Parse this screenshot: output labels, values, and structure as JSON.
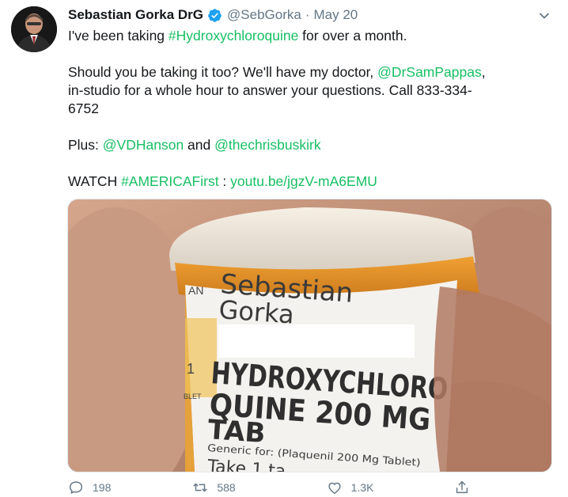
{
  "tweet": {
    "author_name": "Sebastian Gorka DrG",
    "handle": "@SebGorka",
    "separator": "·",
    "date": "May 20",
    "text": {
      "l1_a": "I've been taking ",
      "l1_tag": "#Hydroxychloroquine",
      "l1_b": " for over a month.",
      "l2_a": "Should you be taking it too? We'll have my doctor, ",
      "l2_mention": "@DrSamPappas",
      "l2_b": ",",
      "l3": "in-studio for a whole hour to answer your questions. Call 833-334-",
      "l4": "6752",
      "l5_a": "Plus: ",
      "l5_m1": "@VDHanson",
      "l5_b": " and ",
      "l5_m2": "@thechrisbuskirk",
      "l6_a": "WATCH ",
      "l6_tag": "#AMERICAFirst",
      "l6_b": " : ",
      "l6_url": "youtu.be/jgzV-mA6EMU"
    }
  },
  "media": {
    "label_name_1": "Sebastian",
    "label_name_2": "Gorka",
    "drug_line_1": "HYDROXYCHLORO",
    "drug_line_2": "QUINE 200 MG",
    "drug_line_3": "TAB",
    "generic_line": "Generic for: (Plaquenil 200 Mg Tablet)",
    "take_line": "Take 1 ta",
    "side_mark_1": "AN",
    "side_mark_2": "1",
    "side_mark_3": "BLET"
  },
  "actions": {
    "replies": "198",
    "retweets": "588",
    "likes": "1.3K"
  },
  "colors": {
    "link": "#17bf63",
    "verified": "#1da1f2",
    "muted": "#657786"
  },
  "icons": [
    "verified-badge-icon",
    "chevron-down-icon",
    "reply-icon",
    "retweet-icon",
    "like-icon",
    "share-icon"
  ]
}
